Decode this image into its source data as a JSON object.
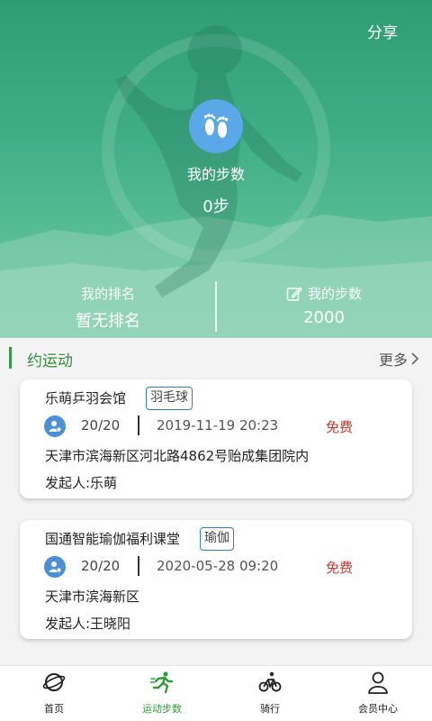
{
  "header": {
    "share_label": "分享"
  },
  "hero": {
    "my_steps_label": "我的步数",
    "my_steps_value": "0步",
    "rank_label": "我的排名",
    "rank_value": "暂无排名",
    "target_label": "我的步数",
    "target_value": "2000"
  },
  "section": {
    "title": "约运动",
    "more_label": "更多"
  },
  "events": [
    {
      "venue": "乐萌乒羽会馆",
      "tag": "羽毛球",
      "count": "20/20",
      "time": "2019-11-19 20:23",
      "fee": "免费",
      "address": "天津市滨海新区河北路4862号贻成集团院内",
      "organizer": "发起人:乐萌"
    },
    {
      "venue": "国通智能瑜伽福利课堂",
      "tag": "瑜伽",
      "count": "20/20",
      "time": "2020-05-28 09:20",
      "fee": "免费",
      "address": "天津市滨海新区",
      "organizer": "发起人:王晓阳"
    }
  ],
  "nav": [
    {
      "label": "首页",
      "icon": "planet-icon"
    },
    {
      "label": "运动步数",
      "icon": "runner-icon",
      "active": true
    },
    {
      "label": "骑行",
      "icon": "bicycle-icon"
    },
    {
      "label": "会员中心",
      "icon": "user-icon"
    }
  ],
  "colors": {
    "accent_green": "#2f9d3a",
    "fee_red": "#c0392b",
    "tag_border": "#2f7fc1",
    "hero_green": "#3fae86"
  }
}
